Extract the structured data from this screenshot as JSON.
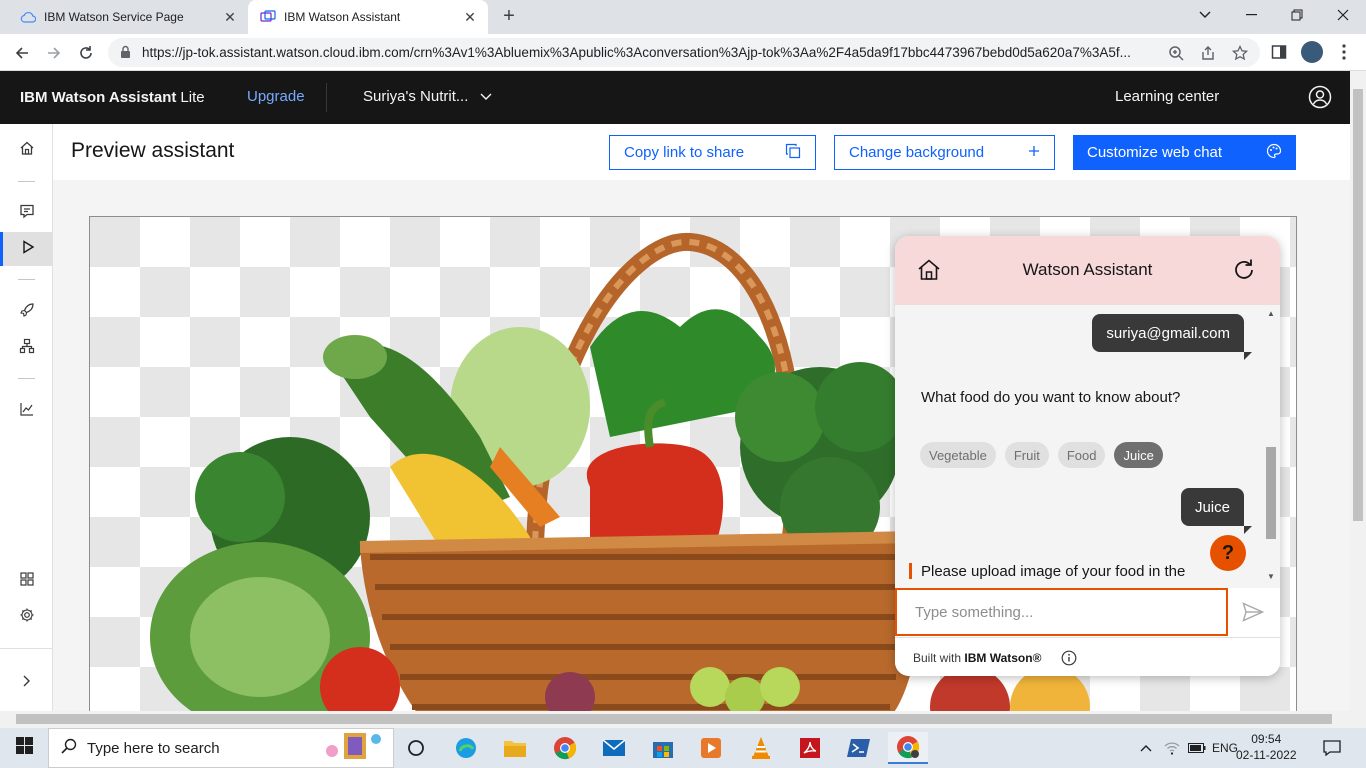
{
  "browser": {
    "tabs": [
      {
        "label": "IBM Watson Service Page",
        "active": false
      },
      {
        "label": "IBM Watson Assistant",
        "active": true
      }
    ],
    "url": "https://jp-tok.assistant.watson.cloud.ibm.com/crn%3Av1%3Abluemix%3Apublic%3Aconversation%3Ajp-tok%3Aa%2F4a5da9f17bbc4473967bebd0d5a620a7%3A5f..."
  },
  "header": {
    "brand_bold": "IBM Watson Assistant",
    "brand_plan": "Lite",
    "upgrade": "Upgrade",
    "assistant_name": "Suriya's Nutrit...",
    "learning_center": "Learning center"
  },
  "page": {
    "title": "Preview assistant",
    "copy_link": "Copy link to share",
    "change_background": "Change background",
    "customize": "Customize web chat"
  },
  "chat": {
    "title": "Watson Assistant",
    "messages": {
      "user_email": "suriya@gmail.com",
      "bot_question": "What food do you want to know about?",
      "user_choice": "Juice",
      "bot_upload": "Please upload image of your food in the"
    },
    "options": [
      "Vegetable",
      "Fruit",
      "Food",
      "Juice"
    ],
    "input_placeholder": "Type something...",
    "built_with_prefix": "Built with ",
    "built_with_brand": "IBM Watson®",
    "help": "?"
  },
  "taskbar": {
    "search_placeholder": "Type here to search",
    "language": "ENG",
    "time": "09:54",
    "date": "02-11-2022"
  },
  "colors": {
    "ibm_blue": "#0f62fe",
    "header_black": "#161616",
    "chat_header_pink": "#f7d9da",
    "accent_orange": "#e65100"
  }
}
